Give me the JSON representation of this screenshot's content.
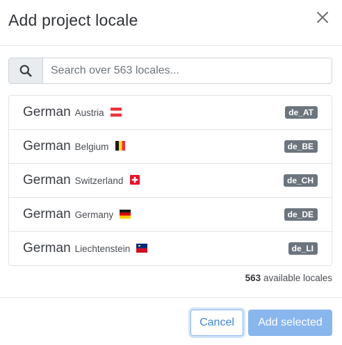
{
  "modal": {
    "title": "Add project locale",
    "close_icon": "close-icon"
  },
  "search": {
    "icon": "search-icon",
    "placeholder": "Search over 563 locales..."
  },
  "locales": [
    {
      "language": "German",
      "region": "Austria",
      "flag": "austria-flag",
      "code": "de_AT"
    },
    {
      "language": "German",
      "region": "Belgium",
      "flag": "belgium-flag",
      "code": "de_BE"
    },
    {
      "language": "German",
      "region": "Switzerland",
      "flag": "switzerland-flag",
      "code": "de_CH"
    },
    {
      "language": "German",
      "region": "Germany",
      "flag": "germany-flag",
      "code": "de_DE"
    },
    {
      "language": "German",
      "region": "Liechtenstein",
      "flag": "liechtenstein-flag",
      "code": "de_LI"
    }
  ],
  "summary": {
    "count": "563",
    "label": "available locales"
  },
  "footer": {
    "cancel_label": "Cancel",
    "add_label": "Add selected"
  },
  "colors": {
    "primary": "#3f86d6",
    "primary_disabled": "#8ab6ee",
    "badge": "#6c757d"
  }
}
